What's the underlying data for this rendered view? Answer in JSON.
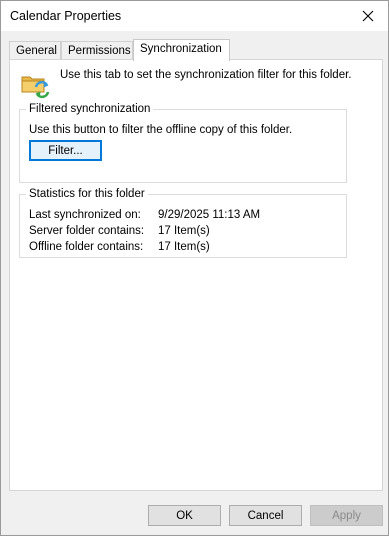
{
  "window": {
    "title": "Calendar Properties",
    "close_glyph": "✕"
  },
  "tabs": [
    {
      "label": "General"
    },
    {
      "label": "Permissions"
    },
    {
      "label": "Synchronization"
    }
  ],
  "intro": {
    "icon": "sync-folder-icon",
    "text": "Use this tab to set the synchronization filter for this folder."
  },
  "filtered": {
    "title": "Filtered synchronization",
    "description": "Use this button to filter the offline copy of this folder.",
    "filter_button": "Filter..."
  },
  "stats": {
    "title": "Statistics for this folder",
    "rows": [
      {
        "label": "Last synchronized on:",
        "value": "9/29/2025 11:13 AM"
      },
      {
        "label": "Server folder contains:",
        "value": "17 Item(s)"
      },
      {
        "label": "Offline folder contains:",
        "value": "17 Item(s)"
      }
    ]
  },
  "buttons": {
    "ok": "OK",
    "cancel": "Cancel",
    "apply": "Apply"
  },
  "colors": {
    "focus_border": "#0078d7",
    "dialog_bg": "#f0f0f0"
  }
}
